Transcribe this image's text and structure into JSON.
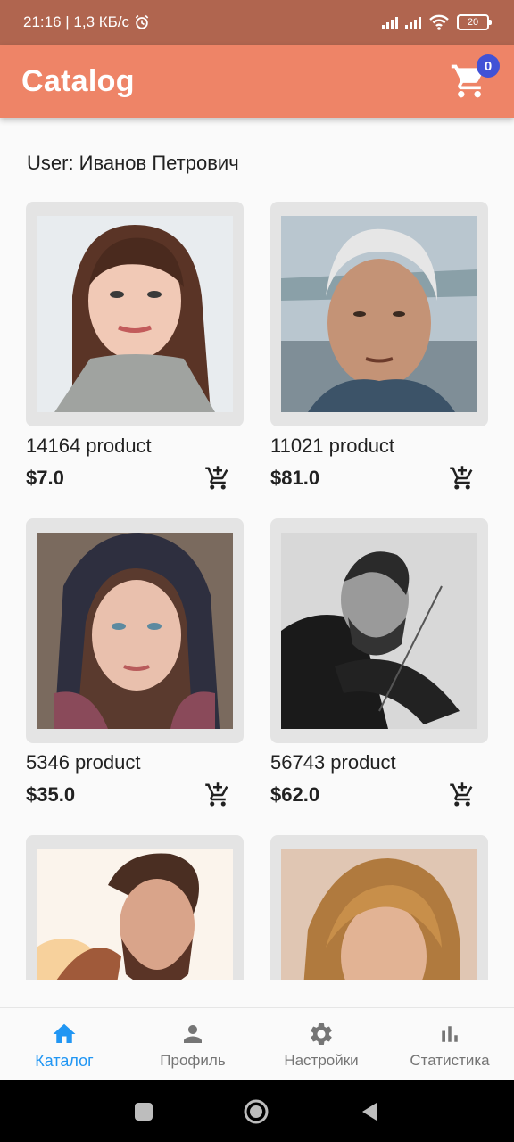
{
  "status_bar": {
    "time_speed": "21:16 | 1,3 КБ/с",
    "battery": "20"
  },
  "app_bar": {
    "title": "Catalog",
    "cart_count": "0"
  },
  "user_line": "User: Иванов Петрович",
  "products": [
    {
      "name": "14164 product",
      "price": "$7.0"
    },
    {
      "name": "11021 product",
      "price": "$81.0"
    },
    {
      "name": "5346 product",
      "price": "$35.0"
    },
    {
      "name": "56743 product",
      "price": "$62.0"
    },
    {
      "name": "",
      "price": ""
    },
    {
      "name": "",
      "price": ""
    }
  ],
  "bottom_nav": [
    {
      "label": "Каталог",
      "icon": "home-icon",
      "active": true
    },
    {
      "label": "Профиль",
      "icon": "person-icon",
      "active": false
    },
    {
      "label": "Настройки",
      "icon": "gear-icon",
      "active": false
    },
    {
      "label": "Статистика",
      "icon": "bar-chart-icon",
      "active": false
    }
  ],
  "colors": {
    "status_bar": "#b0654f",
    "app_bar": "#ee8467",
    "badge": "#4152d6",
    "active_nav": "#2196f3"
  }
}
